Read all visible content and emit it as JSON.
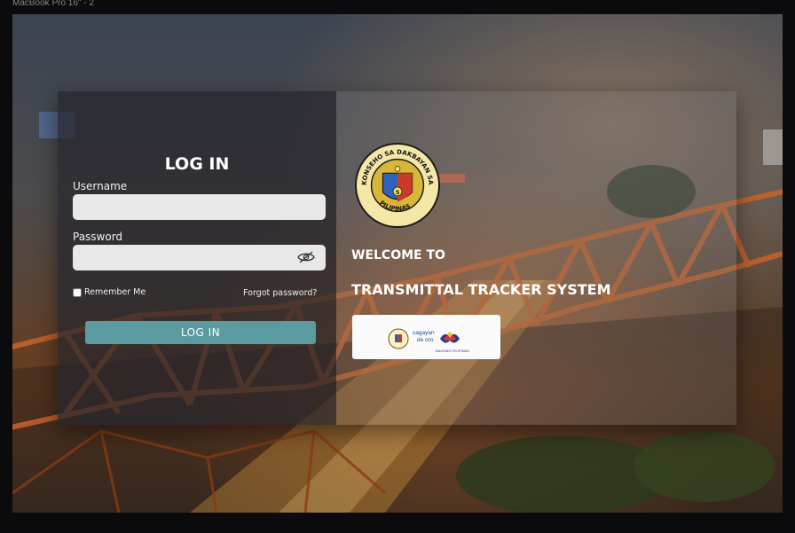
{
  "frame": {
    "label": "MacBook Pro 16\" - 2"
  },
  "login": {
    "title": "LOG IN",
    "username_label": "Username",
    "username_value": "",
    "password_label": "Password",
    "password_value": "",
    "remember_label": "Remember Me",
    "remember_checked": false,
    "forgot_label": "Forgot password?",
    "button_label": "LOG IN",
    "button_color": "#5a9ba2"
  },
  "welcome": {
    "line1": "WELCOME TO",
    "line2": "TRANSMITTAL TRACKER SYSTEM",
    "seal_top_text": "KONSEHO SA DAKBAYAN SA CAGAYAN DE ORO",
    "seal_bottom_text": "PILIPINAS",
    "seal_number": "5"
  },
  "partner_logos": {
    "city_wordmark_line1": "cagayan",
    "city_wordmark_line2": "de oro",
    "bagong_pilipinas": "BAGONG PILIPINAS"
  }
}
